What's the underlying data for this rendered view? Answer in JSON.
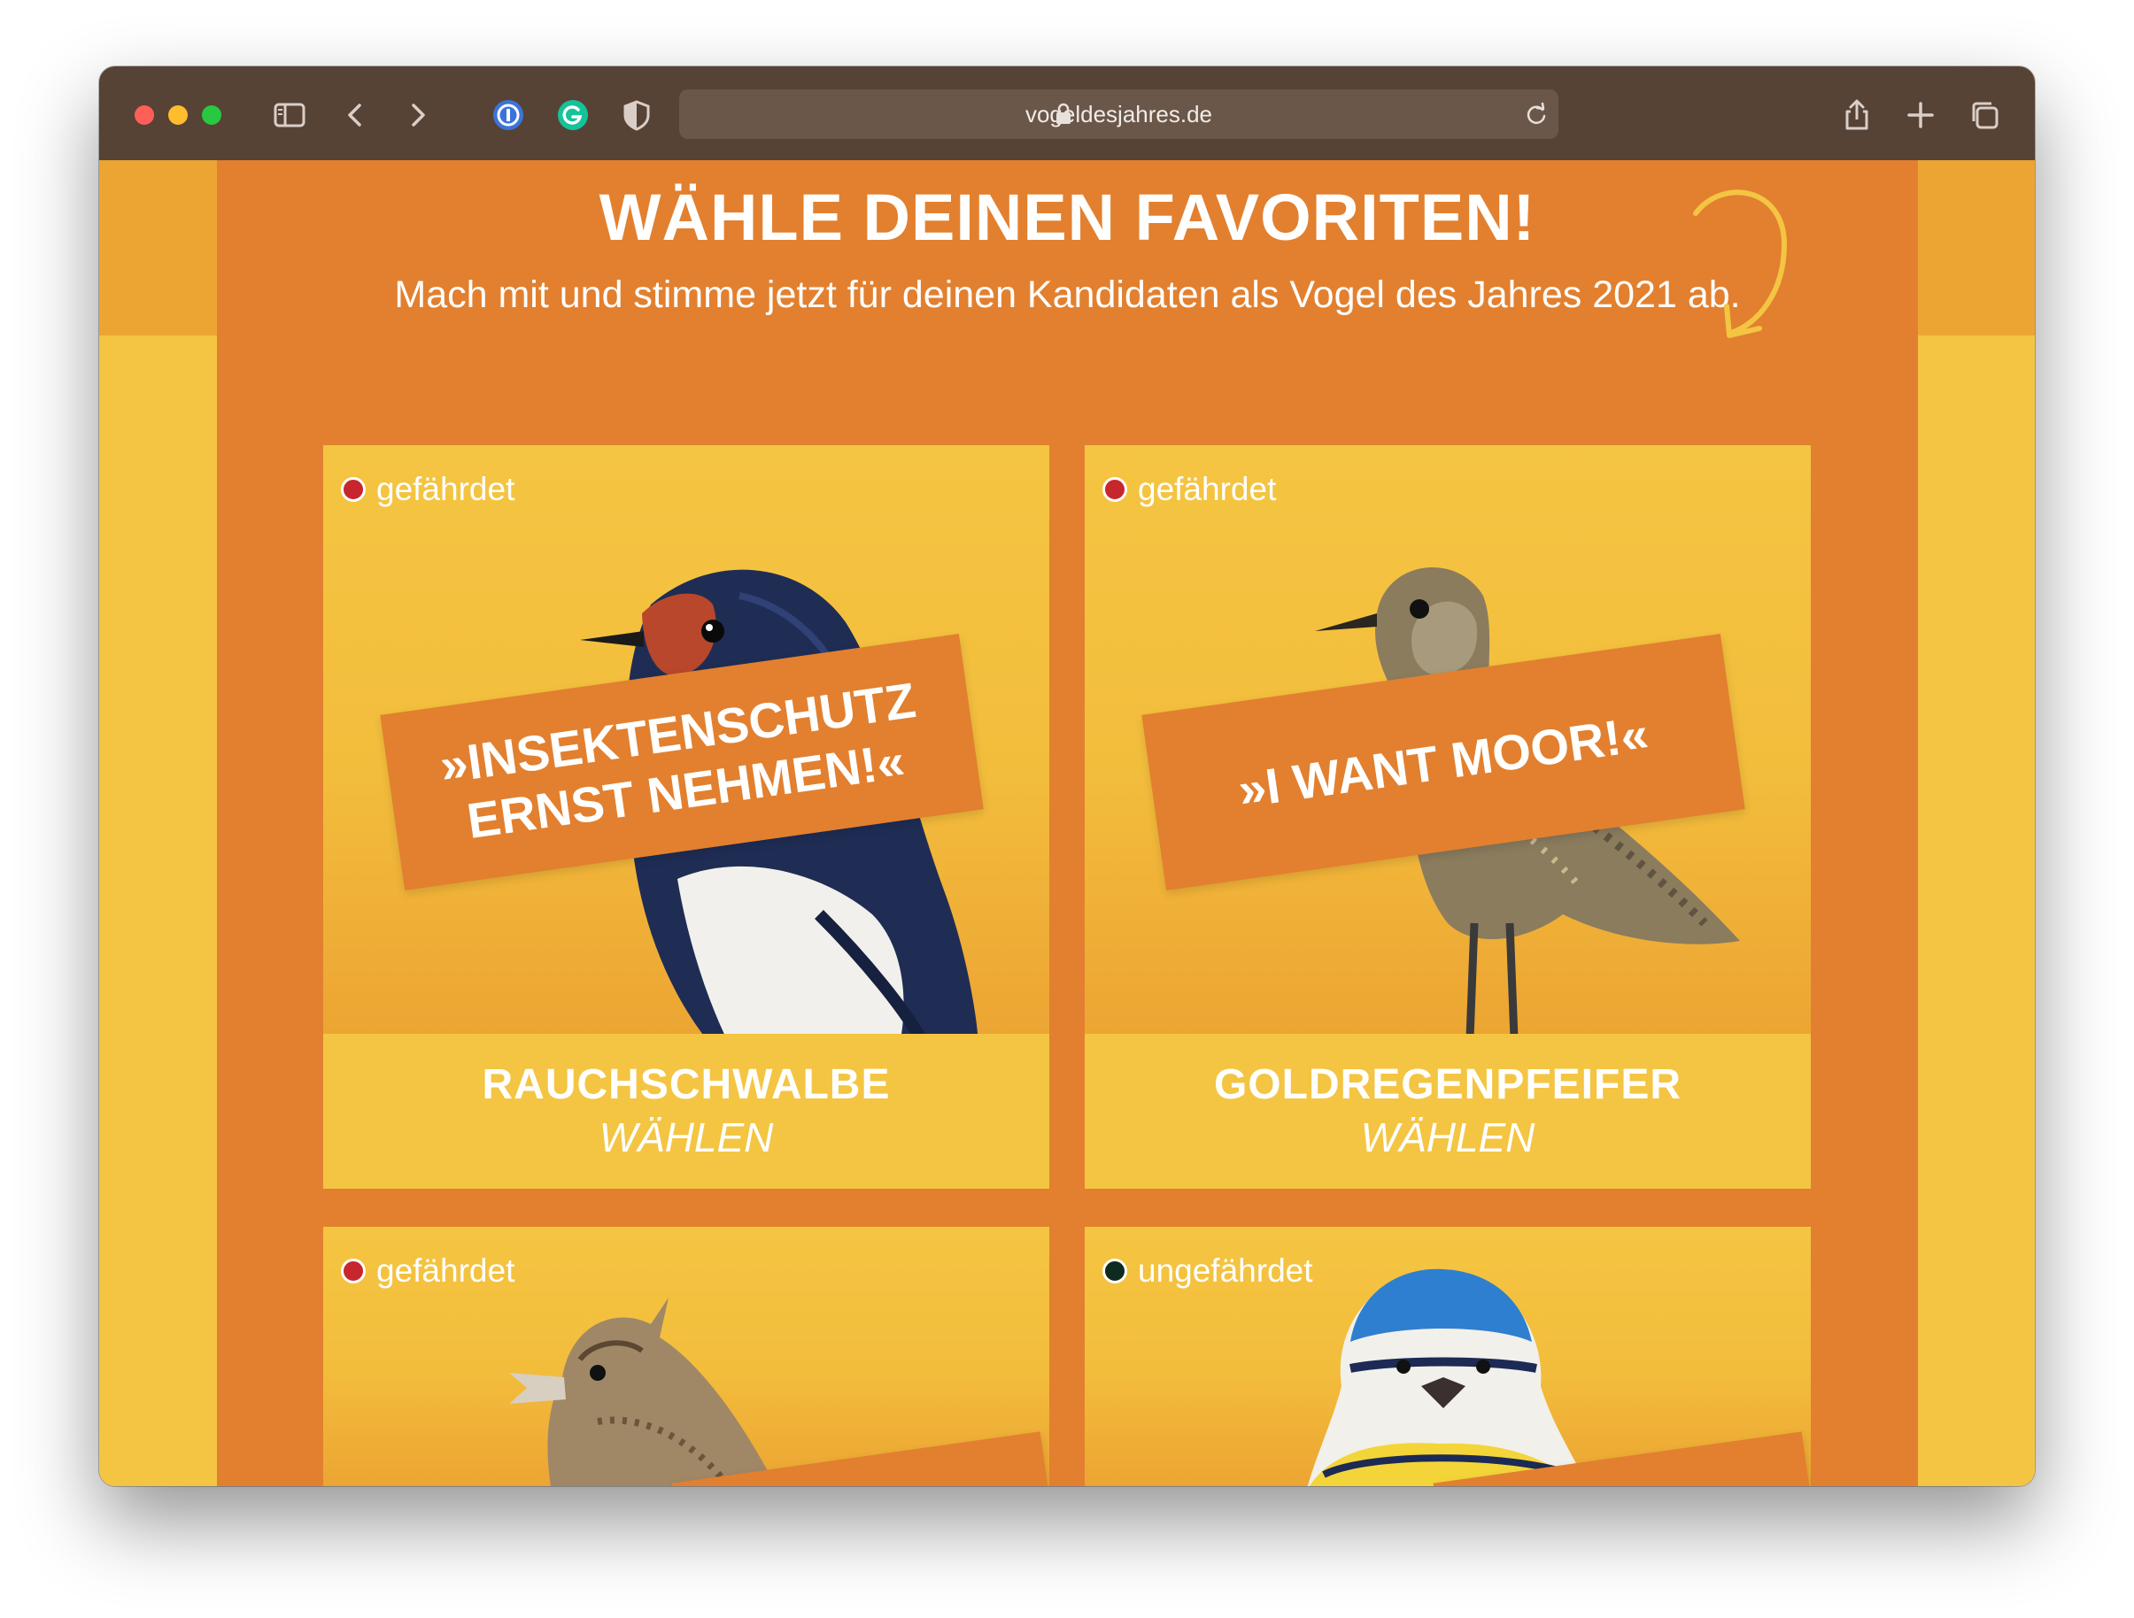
{
  "browser": {
    "url": "vogeldesjahres.de",
    "icons": [
      "sidebar-icon",
      "back-icon",
      "forward-icon",
      "password-manager-icon",
      "grammarly-icon",
      "shield-icon",
      "lock-icon",
      "reload-icon",
      "share-icon",
      "new-tab-icon",
      "tabs-overview-icon"
    ]
  },
  "header": {
    "title": "WÄHLE DEINEN FAVORITEN!",
    "subtitle": "Mach mit und stimme jetzt für deinen Kandidaten als Vogel des Jahres 2021 ab."
  },
  "colors": {
    "endangered": "#c8262d",
    "not_endangered": "#0f2a1e",
    "orange": "#e2802f",
    "yellow": "#f4c542"
  },
  "cards": [
    {
      "status": "gefährdet",
      "slogan_line1": "»INSEKTENSCHUTZ",
      "slogan_line2": "ERNST NEHMEN!«",
      "name": "RAUCHSCHWALBE",
      "vote": "WÄHLEN"
    },
    {
      "status": "gefährdet",
      "slogan_line1": "»I WANT MOOR!«",
      "name": "GOLDREGENPFEIFER",
      "vote": "WÄHLEN"
    },
    {
      "status": "gefährdet"
    },
    {
      "status": "ungefährdet"
    }
  ]
}
